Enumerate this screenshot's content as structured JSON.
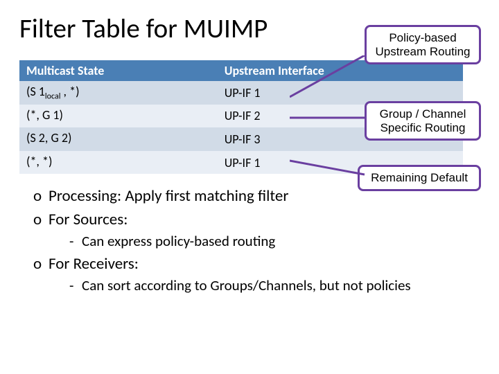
{
  "title": "Filter Table for MUIMP",
  "table": {
    "headers": {
      "col1": "Multicast State",
      "col2": "Upstream Interface"
    },
    "rows": [
      {
        "state_pre": "(S 1",
        "state_sub": "local",
        "state_post": " , *)",
        "iface": "UP-IF 1"
      },
      {
        "state_pre": "(*, G 1)",
        "state_sub": "",
        "state_post": "",
        "iface": "UP-IF 2"
      },
      {
        "state_pre": "(S 2, G 2)",
        "state_sub": "",
        "state_post": "",
        "iface": "UP-IF 3"
      },
      {
        "state_pre": "(*, *)",
        "state_sub": "",
        "state_post": "",
        "iface": "UP-IF 1"
      }
    ]
  },
  "callouts": {
    "policy": {
      "line1": "Policy-based",
      "line2": "Upstream Routing"
    },
    "group": {
      "line1": "Group / Channel",
      "line2": "Specific Routing"
    },
    "default": {
      "line1": "Remaining Default"
    }
  },
  "bullets": {
    "b1a": "Processing: Apply first matching filter",
    "b1b": "For Sources:",
    "b2b": "Can express policy-based routing",
    "b1c": "For Receivers:",
    "b2c": "Can sort according to Groups/Channels, but not policies",
    "mark1": "o",
    "mark2": "-"
  }
}
